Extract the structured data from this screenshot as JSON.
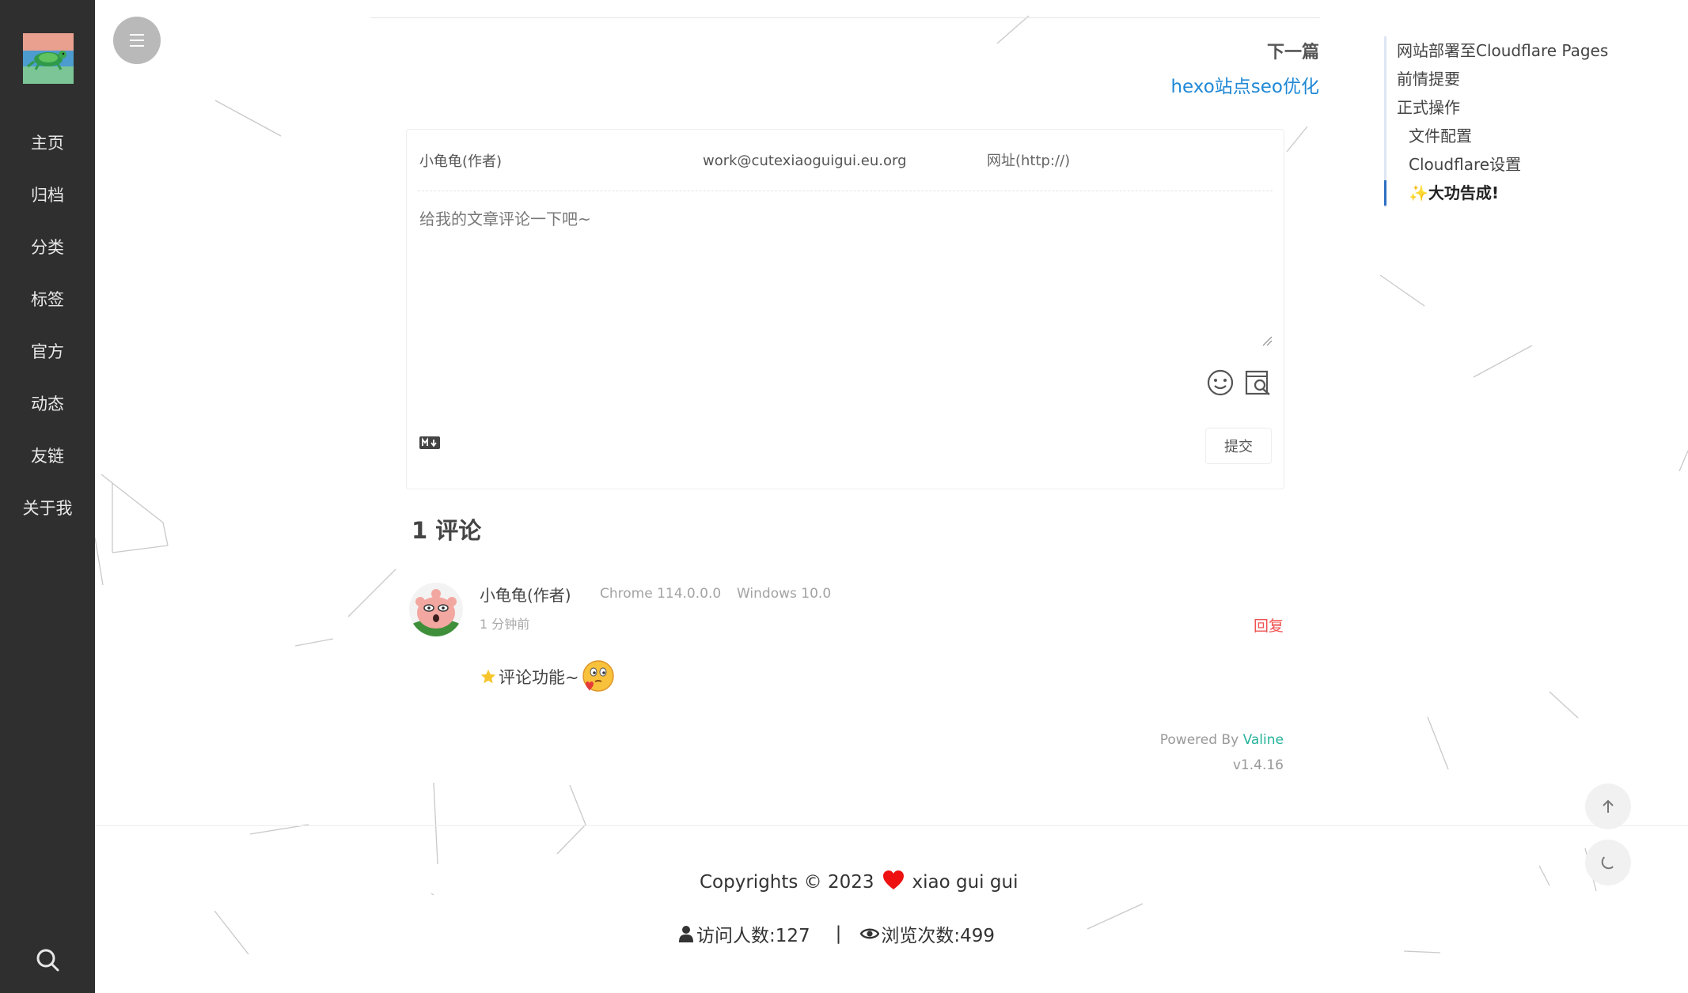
{
  "sidebar": {
    "nav": [
      {
        "label": "主页"
      },
      {
        "label": "归档"
      },
      {
        "label": "分类"
      },
      {
        "label": "标签"
      },
      {
        "label": "官方"
      },
      {
        "label": "动态"
      },
      {
        "label": "友链"
      },
      {
        "label": "关于我"
      }
    ]
  },
  "next_post": {
    "label": "下一篇",
    "title": "hexo站点seo优化"
  },
  "comment_form": {
    "nick_value": "小龟龟(作者)",
    "email_value": "work@cutexiaoguigui.eu.org",
    "link_placeholder": "网址(http://)",
    "textarea_placeholder": "给我的文章评论一下吧~",
    "submit_label": "提交"
  },
  "comments": {
    "count_label": "1 评论",
    "items": [
      {
        "nick": "小龟龟(作者)",
        "browser": "Chrome 114.0.0.0",
        "os": "Windows 10.0",
        "time": "1 分钟前",
        "reply_label": "回复",
        "text": "评论功能~"
      }
    ]
  },
  "powered": {
    "prefix": "Powered By",
    "name": "Valine",
    "version": "v1.4.16"
  },
  "footer": {
    "copyright_prefix": "Copyrights © 2023",
    "author": "xiao gui gui",
    "visitors": "访问人数:127",
    "separator": "|",
    "views": "浏览次数:499"
  },
  "toc": [
    {
      "label": "网站部署至Cloudflare Pages",
      "level": 1
    },
    {
      "label": "前情提要",
      "level": 1
    },
    {
      "label": "正式操作",
      "level": 1
    },
    {
      "label": "文件配置",
      "level": 2
    },
    {
      "label": "Cloudflare设置",
      "level": 2
    },
    {
      "label": "✨大功告成!",
      "level": 2,
      "active": true
    }
  ],
  "colors": {
    "sidebar_bg": "#2f2f2f",
    "link": "#1f88d6",
    "reply": "#ef5350",
    "valine": "#24b29a",
    "toc_active": "#2f6fc2"
  },
  "icons": [
    "menu-icon",
    "search-icon",
    "emoji-icon",
    "preview-icon",
    "markdown-icon",
    "heart-icon",
    "user-icon",
    "eye-icon",
    "arrow-up-icon",
    "moon-icon"
  ]
}
